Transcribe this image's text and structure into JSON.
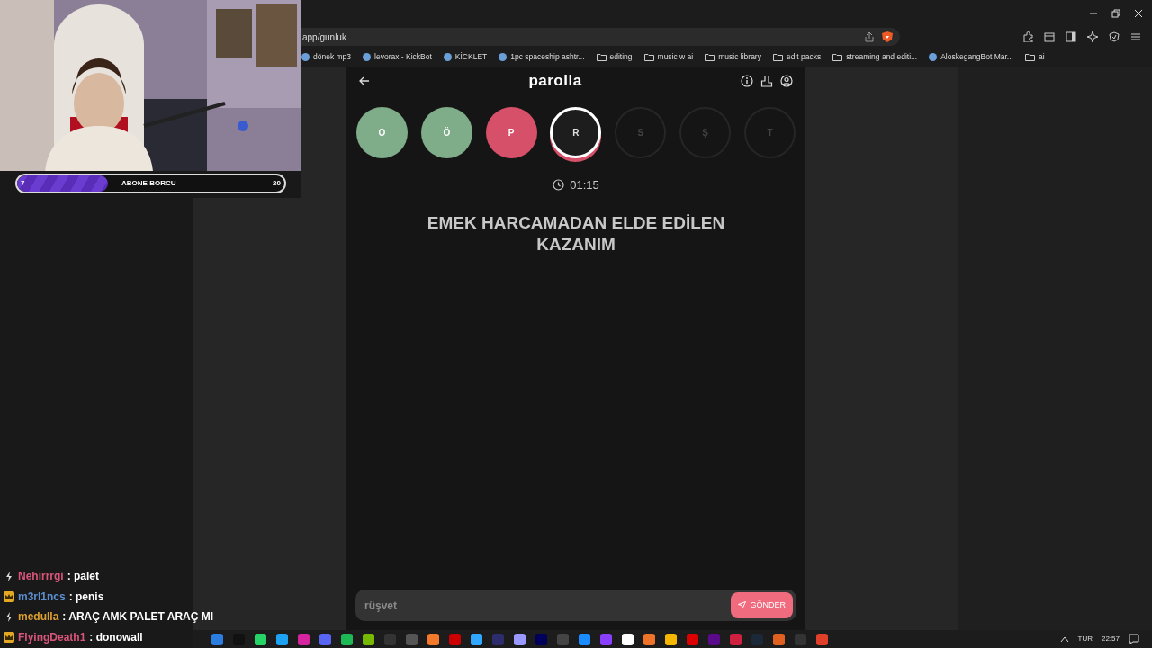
{
  "stream_overlay": {
    "goal": {
      "current": "7",
      "label": "ABONE BORCU",
      "target": "20",
      "level": 0.34
    }
  },
  "chat": [
    {
      "kind": "bolt",
      "user": "Nehirrrgi",
      "color": "#d9557a",
      "message": ": palet"
    },
    {
      "kind": "crown",
      "user": "m3rl1ncs",
      "color": "#5b8fd0",
      "message": ": penis"
    },
    {
      "kind": "bolt",
      "user": "medulla",
      "color": "#e0a030",
      "message": ": ARAÇ AMK PALET ARAÇ MI"
    },
    {
      "kind": "crown",
      "user": "FlyingDeath1",
      "color": "#d9557a",
      "message": ": donowall"
    }
  ],
  "browser": {
    "address": "app/gunluk",
    "bookmarks": [
      {
        "kind": "site",
        "label": "dönek mp3"
      },
      {
        "kind": "site",
        "label": "levorax - KickBot"
      },
      {
        "kind": "site",
        "label": "KİCKLET"
      },
      {
        "kind": "site",
        "label": "1pc spaceship ashtr..."
      },
      {
        "kind": "folder",
        "label": "editing"
      },
      {
        "kind": "folder",
        "label": "music w ai"
      },
      {
        "kind": "folder",
        "label": "music library"
      },
      {
        "kind": "folder",
        "label": "edit packs"
      },
      {
        "kind": "folder",
        "label": "streaming and editi..."
      },
      {
        "kind": "site",
        "label": "AloskegangBot Mar..."
      },
      {
        "kind": "folder",
        "label": "ai"
      }
    ]
  },
  "app": {
    "title": "parolla",
    "letters": [
      {
        "letter": "O",
        "kind": "correct"
      },
      {
        "letter": "Ö",
        "kind": "correct"
      },
      {
        "letter": "P",
        "kind": "wrong"
      },
      {
        "letter": "R",
        "kind": "current"
      },
      {
        "letter": "S",
        "kind": "pending"
      },
      {
        "letter": "Ş",
        "kind": "pending"
      },
      {
        "letter": "T",
        "kind": "pending"
      }
    ],
    "timer": "01:15",
    "question": "EMEK HARCAMADAN ELDE EDİLEN KAZANIM",
    "answer": {
      "value": "rüşvet"
    },
    "submit": "GÖNDER"
  },
  "taskbar": {
    "language": "TUR",
    "time": "22:57"
  }
}
